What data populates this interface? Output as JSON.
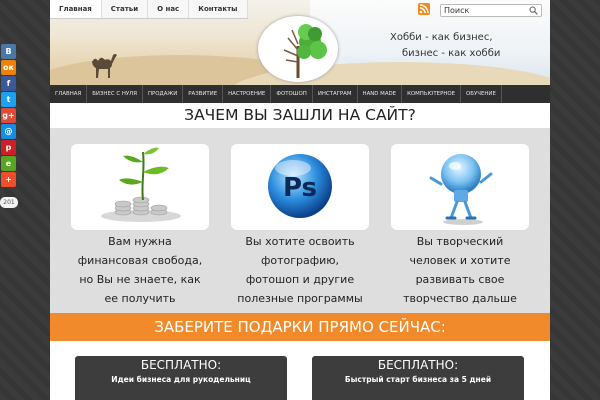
{
  "topnav": [
    "Главная",
    "Статьи",
    "О нас",
    "Контакты"
  ],
  "search": {
    "value": "Поиск"
  },
  "slogan": {
    "line1": "Хобби - как бизнес,",
    "line2": "бизнес - как хобби"
  },
  "mainnav": [
    "ГЛАВНАЯ",
    "БИЗНЕС С НУЛЯ",
    "ПРОДАЖИ",
    "РАЗВИТИЕ",
    "НАСТРОЕНИЕ",
    "ФОТОШОП",
    "ИНСТАГРАМ",
    "HAND MADE",
    "КОМПЬЮТЕРНОЕ",
    "ОБУЧЕНИЕ"
  ],
  "headline": "ЗАЧЕМ ВЫ ЗАШЛИ НА САЙТ?",
  "cards": [
    {
      "lines": [
        "Вам нужна",
        "финансовая свобода,",
        "но Вы не знаете, как",
        "ее получить"
      ],
      "icon": "money-plant-icon"
    },
    {
      "lines": [
        "Вы хотите освоить",
        "фотографию,",
        "фотошоп и другие",
        "полезные программы"
      ],
      "icon": "photoshop-icon"
    },
    {
      "lines": [
        "Вы творческий",
        "человек и хотите",
        "развивать свое",
        "творчество дальше"
      ],
      "icon": "lightbulb-icon"
    }
  ],
  "gifts_heading": "ЗАБЕРИТЕ ПОДАРКИ ПРЯМО СЕЙЧАС:",
  "gifts": [
    {
      "title": "БЕСПЛАТНО:",
      "subtitle": "Идеи бизнеса для рукодельниц"
    },
    {
      "title": "БЕСПЛАТНО:",
      "subtitle": "Быстрый старт бизнеса за 5 дней"
    }
  ],
  "logo_text": "Ps",
  "social": [
    {
      "name": "vk-icon",
      "label": "В",
      "color": "#4a76a8"
    },
    {
      "name": "odnoklassniki-icon",
      "label": "ок",
      "color": "#ee8208"
    },
    {
      "name": "facebook-icon",
      "label": "f",
      "color": "#3b5998"
    },
    {
      "name": "twitter-icon",
      "label": "t",
      "color": "#1da1f2"
    },
    {
      "name": "google-plus-icon",
      "label": "g+",
      "color": "#dd4b39"
    },
    {
      "name": "mail-icon",
      "label": "@",
      "color": "#168de2"
    },
    {
      "name": "pinterest-icon",
      "label": "p",
      "color": "#cb2027"
    },
    {
      "name": "evernote-icon",
      "label": "e",
      "color": "#5ba525"
    },
    {
      "name": "share-more-icon",
      "label": "+",
      "color": "#ef4e2a"
    }
  ],
  "share_count": "201"
}
